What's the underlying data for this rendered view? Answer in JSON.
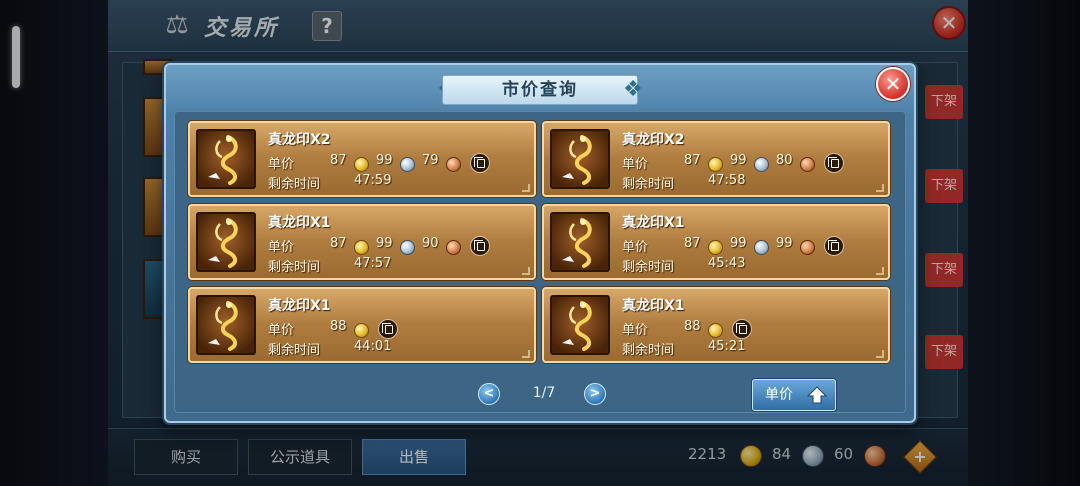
{
  "background": {
    "title": "交易所",
    "help_label": "?",
    "delist_label": "下架",
    "tabs": [
      {
        "label": "购买",
        "active": false
      },
      {
        "label": "公示道具",
        "active": false
      },
      {
        "label": "出售",
        "active": true
      }
    ],
    "currency": {
      "gold": "2213",
      "silver": "84",
      "copper": "60"
    },
    "plus_label": "+"
  },
  "dialog": {
    "title": "市价查询",
    "price_label": "单价",
    "time_label": "剩余时间",
    "listings": [
      {
        "name": "真龙印X2",
        "gold": "87",
        "silver": "99",
        "copper": "79",
        "time": "47:59"
      },
      {
        "name": "真龙印X2",
        "gold": "87",
        "silver": "99",
        "copper": "80",
        "time": "47:58"
      },
      {
        "name": "真龙印X1",
        "gold": "87",
        "silver": "99",
        "copper": "90",
        "time": "47:57"
      },
      {
        "name": "真龙印X1",
        "gold": "87",
        "silver": "99",
        "copper": "99",
        "time": "45:43"
      },
      {
        "name": "真龙印X1",
        "gold": "88",
        "time": "44:01"
      },
      {
        "name": "真龙印X1",
        "gold": "88",
        "time": "45:21"
      }
    ],
    "pagination": {
      "current": 1,
      "total": 7,
      "text": "1/7"
    },
    "sort_label": "单价",
    "prev_label": "<",
    "next_label": ">",
    "close_label": "✕"
  },
  "colors": {
    "dialog_blue": "#4f80a8",
    "card_gold": "#b07d40",
    "close_red": "#d0302a",
    "active_tab": "#2a5580"
  }
}
